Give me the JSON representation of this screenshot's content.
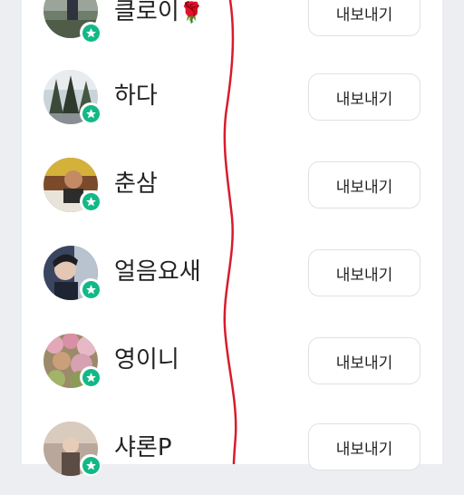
{
  "friends": [
    {
      "name": "클로이",
      "emoji": "🌹",
      "button_label": "내보내기"
    },
    {
      "name": "하다",
      "emoji": "",
      "button_label": "내보내기"
    },
    {
      "name": "춘삼",
      "emoji": "",
      "button_label": "내보내기"
    },
    {
      "name": "얼음요새",
      "emoji": "",
      "button_label": "내보내기"
    },
    {
      "name": "영이니",
      "emoji": "",
      "button_label": "내보내기"
    },
    {
      "name": "샤론P",
      "emoji": "",
      "button_label": "내보내기"
    }
  ],
  "colors": {
    "badge": "#12b886",
    "annotation": "#d81b2c",
    "background": "#eceef1"
  },
  "icons": {
    "badge": "star-icon"
  }
}
